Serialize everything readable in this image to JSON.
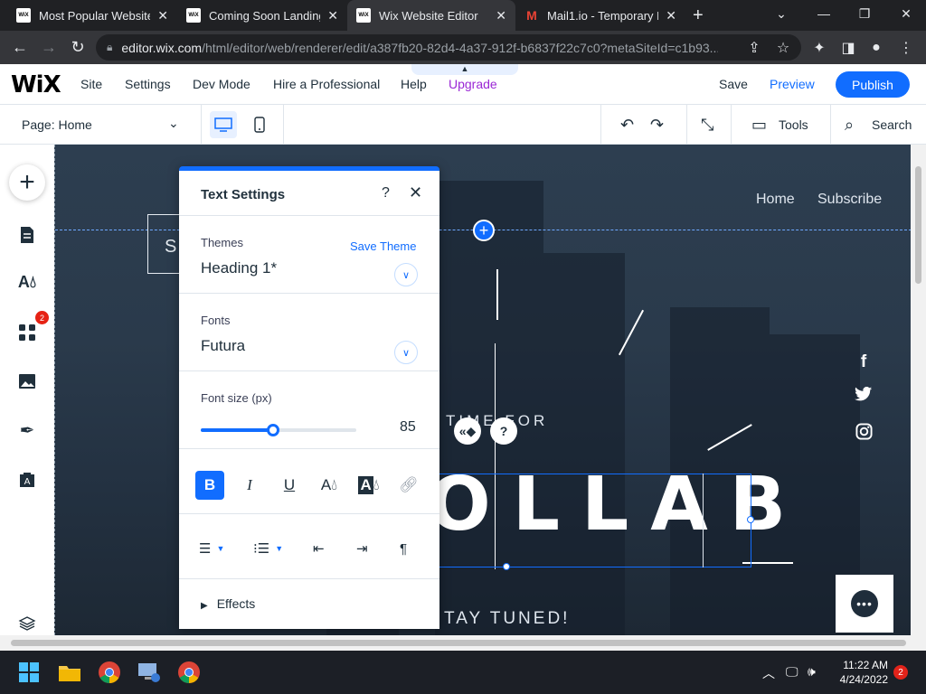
{
  "browser": {
    "tabs": [
      {
        "favicon": "WiX",
        "title": "Most Popular Website"
      },
      {
        "favicon": "WiX",
        "title": "Coming Soon Landing"
      },
      {
        "favicon": "WiX",
        "title": "Wix Website Editor"
      },
      {
        "favicon": "M",
        "title": "Mail1.io - Temporary E"
      }
    ],
    "url_host": "editor.wix.com",
    "url_path": "/html/editor/web/renderer/edit/a387fb20-82d4-4a37-912f-b6837f22c7c0?metaSiteId=c1b93..."
  },
  "editor": {
    "logo": "WiX",
    "menu": [
      "Site",
      "Settings",
      "Dev Mode",
      "Hire a Professional",
      "Help",
      "Upgrade"
    ],
    "save": "Save",
    "preview": "Preview",
    "publish": "Publish",
    "page_selector": "Page: Home",
    "tools": "Tools",
    "search": "Search",
    "apps_badge": "2"
  },
  "site": {
    "nav": [
      "Home",
      "Subscribe"
    ],
    "logo_letter": "S",
    "time_for": "TIME FOR",
    "headline": "OLLAB",
    "stay_tuned": "TAY TUNED!"
  },
  "text_settings": {
    "title": "Text Settings",
    "help": "?",
    "themes_label": "Themes",
    "save_theme": "Save Theme",
    "theme_value": "Heading 1*",
    "fonts_label": "Fonts",
    "font_value": "Futura",
    "font_size_label": "Font size (px)",
    "font_size": 85,
    "font_size_min": 6,
    "font_size_max": 176,
    "effects_label": "Effects"
  },
  "taskbar": {
    "time": "11:22 AM",
    "date": "4/24/2022",
    "notifications": "2"
  },
  "colors": {
    "accent": "#116dff",
    "upgrade": "#9a27d5",
    "chrome_dark": "#202124"
  }
}
